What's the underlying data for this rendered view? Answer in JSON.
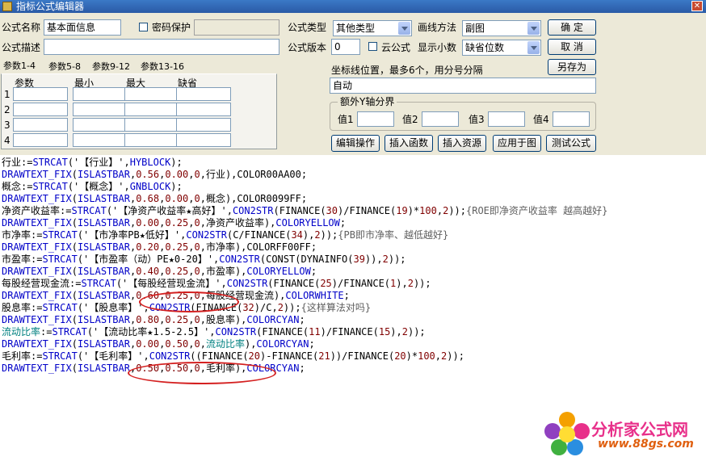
{
  "window": {
    "title": "指标公式编辑器",
    "close_symbol": "✕"
  },
  "form": {
    "name_label": "公式名称",
    "name_value": "基本面信息",
    "password_label": "密码保护",
    "type_label": "公式类型",
    "type_value": "其他类型",
    "draw_method_label": "画线方法",
    "draw_method_value": "副图",
    "desc_label": "公式描述",
    "version_label": "公式版本",
    "version_value": "0",
    "cloud_label": "云公式",
    "decimals_label": "显示小数",
    "decimals_value": "缺省位数",
    "coord_label": "坐标线位置，最多6个，用分号分隔",
    "coord_value": "自动",
    "extra_y_legend": "额外Y轴分界",
    "y_values": [
      "值1",
      "值2",
      "值3",
      "值4"
    ]
  },
  "buttons": {
    "ok": "确  定",
    "cancel": "取  消",
    "save_as": "另存为",
    "edit_ops": "编辑操作",
    "insert_func": "插入函数",
    "insert_res": "插入资源",
    "apply_chart": "应用于图",
    "test": "测试公式"
  },
  "params": {
    "tabs": [
      "参数1-4",
      "参数5-8",
      "参数9-12",
      "参数13-16"
    ],
    "headers": [
      "参数",
      "最小",
      "最大",
      "缺省"
    ],
    "rows": [
      "1",
      "2",
      "3",
      "4"
    ]
  },
  "code_lines": [
    [
      [
        "行业:=",
        "k"
      ],
      [
        "STRCAT",
        "f"
      ],
      [
        "('【行业】',",
        "s"
      ],
      [
        "HYBLOCK",
        "f"
      ],
      [
        ");",
        "s"
      ]
    ],
    [
      [
        "DRAWTEXT_FIX",
        "f"
      ],
      [
        "(",
        "s"
      ],
      [
        "ISLASTBAR",
        "f"
      ],
      [
        ",",
        "s"
      ],
      [
        "0.56",
        "n"
      ],
      [
        ",",
        "s"
      ],
      [
        "0.00",
        "n"
      ],
      [
        ",",
        "s"
      ],
      [
        "0",
        "n"
      ],
      [
        ",行业),",
        "s"
      ],
      [
        "COLOR00AA00",
        "s"
      ],
      [
        ";",
        "s"
      ]
    ],
    [
      [
        "概念:=",
        "k"
      ],
      [
        "STRCAT",
        "f"
      ],
      [
        "('【概念】',",
        "s"
      ],
      [
        "GNBLOCK",
        "f"
      ],
      [
        ");",
        "s"
      ]
    ],
    [
      [
        "DRAWTEXT_FIX",
        "f"
      ],
      [
        "(",
        "s"
      ],
      [
        "ISLASTBAR",
        "f"
      ],
      [
        ",",
        "s"
      ],
      [
        "0.68",
        "n"
      ],
      [
        ",",
        "s"
      ],
      [
        "0.00",
        "n"
      ],
      [
        ",",
        "s"
      ],
      [
        "0",
        "n"
      ],
      [
        ",概念),",
        "s"
      ],
      [
        "COLOR0099FF",
        "s"
      ],
      [
        ";",
        "s"
      ]
    ],
    [
      [
        "净资产收益率:=",
        "k"
      ],
      [
        "STRCAT",
        "f"
      ],
      [
        "('【净资产收益率★高好】',",
        "s"
      ],
      [
        "CON2STR",
        "f"
      ],
      [
        "(FINANCE(",
        "s"
      ],
      [
        "30",
        "n"
      ],
      [
        ")/FINANCE(",
        "s"
      ],
      [
        "19",
        "n"
      ],
      [
        ")*",
        "s"
      ],
      [
        "100",
        "n"
      ],
      [
        ",",
        "s"
      ],
      [
        "2",
        "n"
      ],
      [
        "));",
        "s"
      ],
      [
        "{ROE即净资产收益率 越高越好}",
        "c"
      ]
    ],
    [
      [
        "DRAWTEXT_FIX",
        "f"
      ],
      [
        "(",
        "s"
      ],
      [
        "ISLASTBAR",
        "f"
      ],
      [
        ",",
        "s"
      ],
      [
        "0.00",
        "n"
      ],
      [
        ",",
        "s"
      ],
      [
        "0.25",
        "n"
      ],
      [
        ",",
        "s"
      ],
      [
        "0",
        "n"
      ],
      [
        ",净资产收益率),",
        "s"
      ],
      [
        "COLORYELLOW",
        "f"
      ],
      [
        ";",
        "s"
      ]
    ],
    [
      [
        "市净率:=",
        "k"
      ],
      [
        "STRCAT",
        "f"
      ],
      [
        "('【市净率PB★低好】',",
        "s"
      ],
      [
        "CON2STR",
        "f"
      ],
      [
        "(C/FINANCE(",
        "s"
      ],
      [
        "34",
        "n"
      ],
      [
        "),",
        "s"
      ],
      [
        "2",
        "n"
      ],
      [
        "));",
        "s"
      ],
      [
        "{PB即市净率、越低越好}",
        "c"
      ]
    ],
    [
      [
        "DRAWTEXT_FIX",
        "f"
      ],
      [
        "(",
        "s"
      ],
      [
        "ISLASTBAR",
        "f"
      ],
      [
        ",",
        "s"
      ],
      [
        "0.20",
        "n"
      ],
      [
        ",",
        "s"
      ],
      [
        "0.25",
        "n"
      ],
      [
        ",",
        "s"
      ],
      [
        "0",
        "n"
      ],
      [
        ",市净率),",
        "s"
      ],
      [
        "COLORFF00FF",
        "s"
      ],
      [
        ";",
        "s"
      ]
    ],
    [
      [
        "市盈率:=",
        "k"
      ],
      [
        "STRCAT",
        "f"
      ],
      [
        "('【市盈率（动）PE★0-20】',",
        "s"
      ],
      [
        "CON2STR",
        "f"
      ],
      [
        "(CONST(DYNAINFO(",
        "s"
      ],
      [
        "39",
        "n"
      ],
      [
        ")),",
        "s"
      ],
      [
        "2",
        "n"
      ],
      [
        "));",
        "s"
      ]
    ],
    [
      [
        "DRAWTEXT_FIX",
        "f"
      ],
      [
        "(",
        "s"
      ],
      [
        "ISLASTBAR",
        "f"
      ],
      [
        ",",
        "s"
      ],
      [
        "0.40",
        "n"
      ],
      [
        ",",
        "s"
      ],
      [
        "0.25",
        "n"
      ],
      [
        ",",
        "s"
      ],
      [
        "0",
        "n"
      ],
      [
        ",市盈率),",
        "s"
      ],
      [
        "COLORYELLOW",
        "f"
      ],
      [
        ";",
        "s"
      ]
    ],
    [
      [
        "每股经营现金流:=",
        "k"
      ],
      [
        "STRCAT",
        "f"
      ],
      [
        "('【每股经营现金流】',",
        "s"
      ],
      [
        "CON2STR",
        "f"
      ],
      [
        "(FINANCE(",
        "s"
      ],
      [
        "25",
        "n"
      ],
      [
        ")/FINANCE(",
        "s"
      ],
      [
        "1",
        "n"
      ],
      [
        "),",
        "s"
      ],
      [
        "2",
        "n"
      ],
      [
        "));",
        "s"
      ]
    ],
    [
      [
        "DRAWTEXT_FIX",
        "f"
      ],
      [
        "(",
        "s"
      ],
      [
        "ISLASTBAR",
        "f"
      ],
      [
        ",",
        "s"
      ],
      [
        "0.60",
        "n"
      ],
      [
        ",",
        "s"
      ],
      [
        "0.25",
        "n"
      ],
      [
        ",",
        "s"
      ],
      [
        "0",
        "n"
      ],
      [
        ",每股经营现金流),",
        "s"
      ],
      [
        "COLORWHITE",
        "f"
      ],
      [
        ";",
        "s"
      ]
    ],
    [
      [
        "股息率:=",
        "k"
      ],
      [
        "STRCAT",
        "f"
      ],
      [
        "('【股息率】',",
        "s"
      ],
      [
        "CON2STR",
        "f"
      ],
      [
        "(FINANCE(",
        "s"
      ],
      [
        "32",
        "n"
      ],
      [
        ")/C,",
        "s"
      ],
      [
        "2",
        "n"
      ],
      [
        "));",
        "s"
      ],
      [
        "{这样算法对吗}",
        "c"
      ]
    ],
    [
      [
        "DRAWTEXT_FIX",
        "f"
      ],
      [
        "(",
        "s"
      ],
      [
        "ISLASTBAR",
        "f"
      ],
      [
        ",",
        "s"
      ],
      [
        "0.80",
        "n"
      ],
      [
        ",",
        "s"
      ],
      [
        "0.25",
        "n"
      ],
      [
        ",",
        "s"
      ],
      [
        "0",
        "n"
      ],
      [
        ",股息率),",
        "s"
      ],
      [
        "COLORCYAN",
        "f"
      ],
      [
        ";",
        "s"
      ]
    ],
    [
      [
        "流动比率",
        "m"
      ],
      [
        ":=",
        "k"
      ],
      [
        "STRCAT",
        "f"
      ],
      [
        "('【流动比率★1.5-2.5】',",
        "s"
      ],
      [
        "CON2STR",
        "f"
      ],
      [
        "(FINANCE(",
        "s"
      ],
      [
        "11",
        "n"
      ],
      [
        ")/FINANCE(",
        "s"
      ],
      [
        "15",
        "n"
      ],
      [
        "),",
        "s"
      ],
      [
        "2",
        "n"
      ],
      [
        "));",
        "s"
      ]
    ],
    [
      [
        "DRAWTEXT_FIX",
        "f"
      ],
      [
        "(",
        "s"
      ],
      [
        "ISLASTBAR",
        "f"
      ],
      [
        ",",
        "s"
      ],
      [
        "0.00",
        "n"
      ],
      [
        ",",
        "s"
      ],
      [
        "0.50",
        "n"
      ],
      [
        ",",
        "s"
      ],
      [
        "0",
        "n"
      ],
      [
        ",",
        "s"
      ],
      [
        "流动比率",
        "m"
      ],
      [
        "),",
        "s"
      ],
      [
        "COLORCYAN",
        "f"
      ],
      [
        ";",
        "s"
      ]
    ],
    [
      [
        "毛利率:=",
        "k"
      ],
      [
        "STRCAT",
        "f"
      ],
      [
        "('【毛利率】',",
        "s"
      ],
      [
        "CON2STR",
        "f"
      ],
      [
        "((FINANCE(",
        "s"
      ],
      [
        "20",
        "n"
      ],
      [
        ")-FINANCE(",
        "s"
      ],
      [
        "21",
        "n"
      ],
      [
        "))/FINANCE(",
        "s"
      ],
      [
        "20",
        "n"
      ],
      [
        ")*",
        "s"
      ],
      [
        "100",
        "n"
      ],
      [
        ",",
        "s"
      ],
      [
        "2",
        "n"
      ],
      [
        "));",
        "s"
      ]
    ],
    [
      [
        "DRAWTEXT_FIX",
        "f"
      ],
      [
        "(",
        "s"
      ],
      [
        "ISLASTBAR",
        "f"
      ],
      [
        ",",
        "s"
      ],
      [
        "0.50",
        "n"
      ],
      [
        ",",
        "s"
      ],
      [
        "0.50",
        "n"
      ],
      [
        ",",
        "s"
      ],
      [
        "0",
        "n"
      ],
      [
        ",毛利率),",
        "s"
      ],
      [
        "COLORCYAN",
        "f"
      ],
      [
        ";",
        "s"
      ]
    ]
  ],
  "watermark": {
    "title": "分析家公式网",
    "url": "www.88gs.com"
  }
}
